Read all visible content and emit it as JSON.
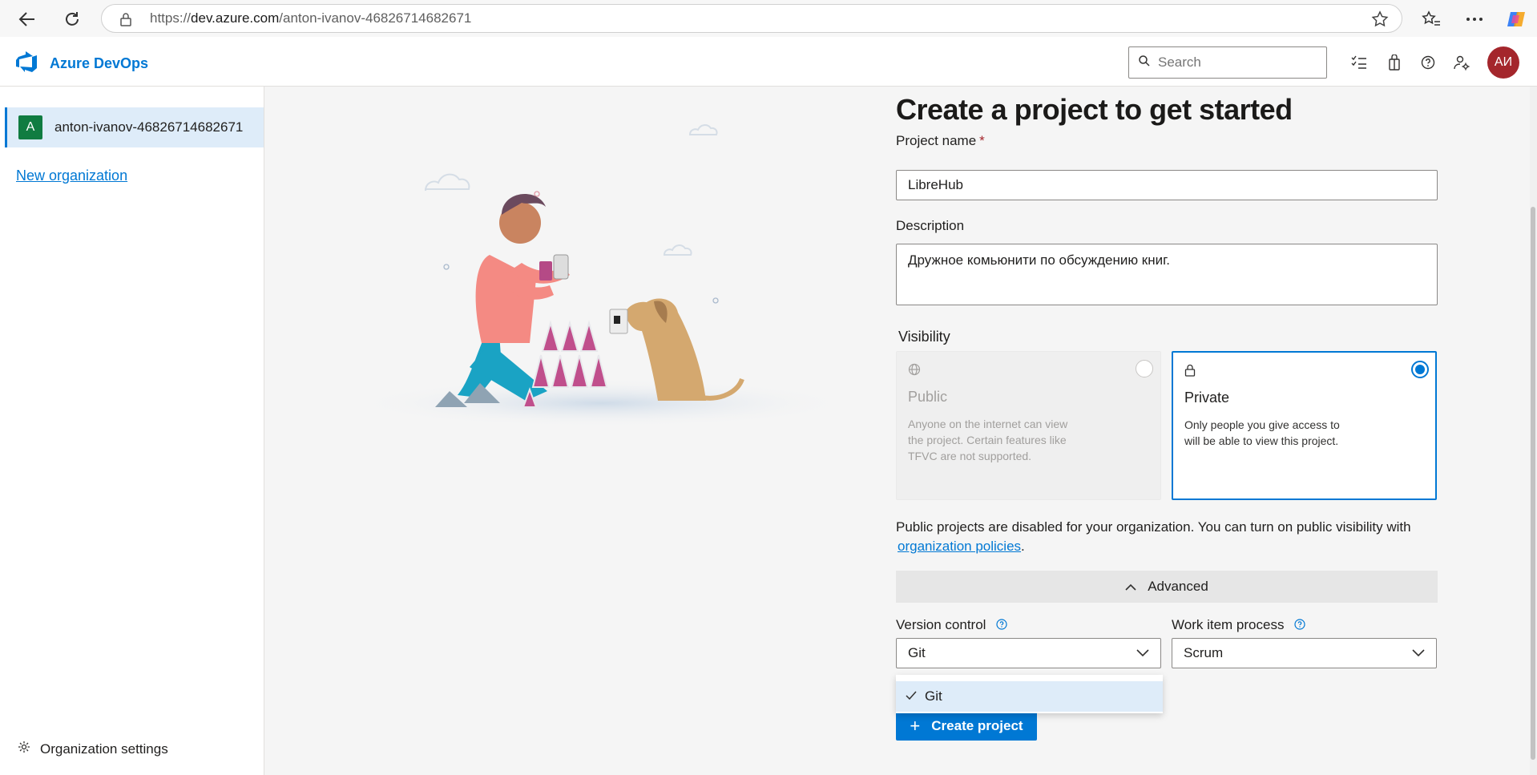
{
  "browser": {
    "url_scheme": "https://",
    "url_host": "dev.azure.com",
    "url_path": "/anton-ivanov-46826714682671"
  },
  "header": {
    "brand": "Azure DevOps",
    "search_placeholder": "Search",
    "avatar_initials": "АИ",
    "icons": [
      "task-list-icon",
      "shopping-bag-icon",
      "help-icon",
      "user-settings-icon"
    ]
  },
  "sidebar": {
    "org_badge": "A",
    "org_name": "anton-ivanov-46826714682671",
    "new_org": "New organization",
    "org_settings": "Organization settings"
  },
  "form": {
    "title": "Create a project to get started",
    "project_name_label": "Project name",
    "required_mark": "*",
    "project_name_value": "LibreHub",
    "description_label": "Description",
    "description_value": "Дружное комьюнити по обсуждению книг.",
    "visibility_label": "Visibility",
    "public": {
      "title": "Public",
      "desc": "Anyone on the internet can view the project. Certain features like TFVC are not supported.",
      "selected": false
    },
    "private": {
      "title": "Private",
      "desc": "Only people you give access to will be able to view this project.",
      "selected": true
    },
    "policy_note": "Public projects are disabled for your organization. You can turn on public visibility with",
    "policy_link": "organization policies",
    "policy_end": ".",
    "advanced_label": "Advanced",
    "version_control_label": "Version control",
    "version_control_value": "Git",
    "work_item_label": "Work item process",
    "work_item_value": "Scrum",
    "dropdown_options": [
      "Git"
    ],
    "create_button": "Create project"
  },
  "colors": {
    "accent": "#0078d4",
    "avatar_bg": "#a4262c",
    "org_badge_bg": "#107c41",
    "selected_bg": "#deecf9"
  }
}
